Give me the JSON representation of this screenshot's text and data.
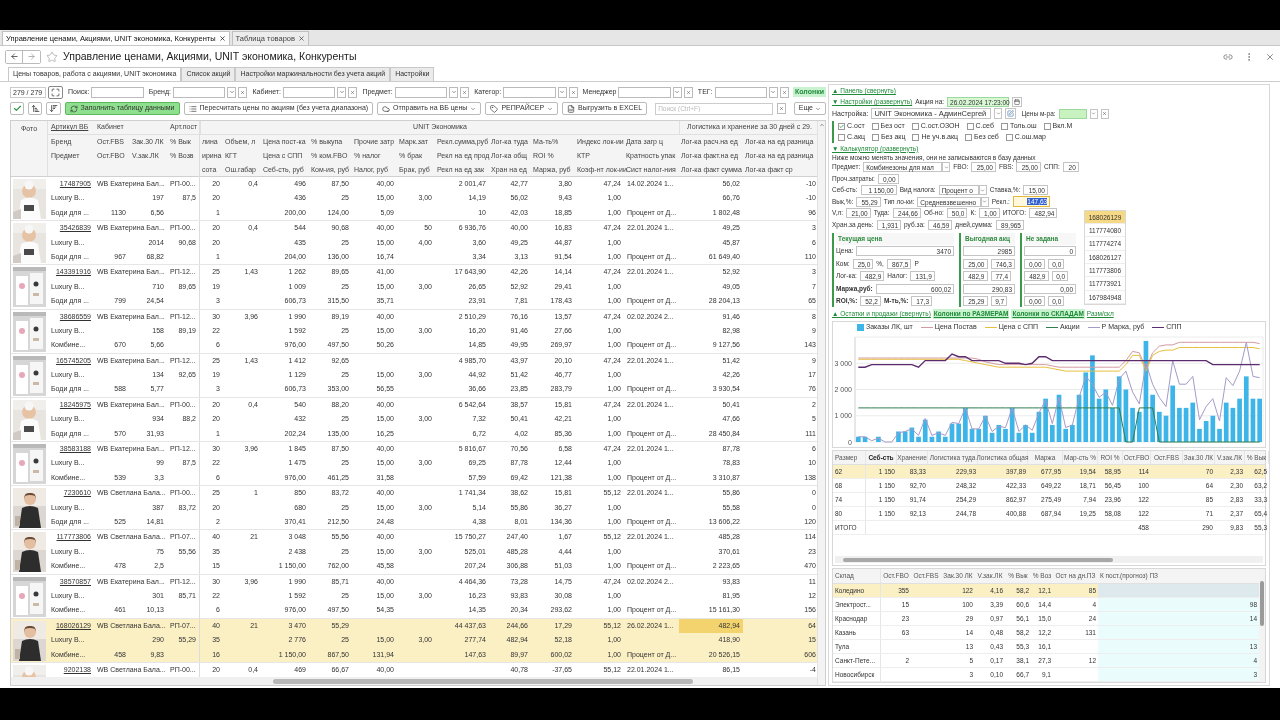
{
  "page_tabs": [
    {
      "label": "Управление ценами, Акциями, UNIT экономика, Конкуренты",
      "selected": true
    },
    {
      "label": "Таблица товаров",
      "selected": false
    }
  ],
  "window": {
    "title": "Управление ценами, Акциями, UNIT экономика, Конкуренты"
  },
  "tabs": [
    {
      "label": "Цены товаров, работа с акциями, UNIT экономика",
      "selected": true
    },
    {
      "label": "Список акций",
      "selected": false
    },
    {
      "label": "Настройки маржинальности без учета акций",
      "selected": false
    },
    {
      "label": "Настройки",
      "selected": false
    }
  ],
  "filters": {
    "counter": "279 / 279",
    "fields": [
      {
        "label": "Поиск:",
        "kind": "text"
      },
      {
        "label": "Бренд:",
        "kind": "select"
      },
      {
        "label": "Кабинет:",
        "kind": "select"
      },
      {
        "label": "Предмет:",
        "kind": "select"
      },
      {
        "label": "Категор:",
        "kind": "select"
      },
      {
        "label": "Менеджер",
        "kind": "select"
      },
      {
        "label": "ТЕГ:",
        "kind": "select"
      }
    ],
    "columns_link": "Колонки"
  },
  "toolbar": {
    "buttons": [
      {
        "label": "Заполнить таблицу данными",
        "kind": "primary"
      },
      {
        "label": "Пересчитать цены по акциям (без учета диапазона)",
        "kind": "plain"
      },
      {
        "label": "Отправить на ВБ цены",
        "kind": "menu"
      },
      {
        "label": "РЕПРАЙСЕР",
        "kind": "menu"
      },
      {
        "label": "Выгрузить в EXCEL",
        "kind": "plain"
      }
    ],
    "search_placeholder": "Поиск (Ctrl+F)",
    "more": "Еще"
  },
  "table": {
    "photo_header": "Фото",
    "fixed_columns": [
      {
        "labels": [
          "Артикул ВБ",
          "Бренд",
          "Предмет"
        ]
      },
      {
        "labels": [
          "Кабинет",
          "Ост.FBS",
          "Ост.FBO"
        ]
      },
      {
        "labels": [
          "Зак.30 ЛК",
          "V.зак.ЛК"
        ]
      },
      {
        "labels": [
          "Арт.пост",
          "% Вык",
          "% Возв"
        ]
      }
    ],
    "groups": [
      {
        "label": "UNIT Экономика",
        "columns": [
          {
            "labels": [
              "лина",
              "ирина",
              "сота"
            ]
          },
          {
            "labels": [
              "Объем, л",
              "КГТ",
              "Ош.габар"
            ]
          },
          {
            "labels": [
              "Цена пост-ка",
              "Цена с СПП",
              "Себ-сть, руб"
            ]
          },
          {
            "labels": [
              "% выкупа",
              "% ком.FBO",
              "Ком-ия, руб"
            ]
          },
          {
            "labels": [
              "Прочие затр",
              "% налог",
              "Налог, руб"
            ]
          },
          {
            "labels": [
              "Марк.зат",
              "% брак",
              "Брак, руб"
            ]
          },
          {
            "labels": [
              "Рекл.сумма,руб",
              "Рекл на ед прод",
              "Рекл на ед зак"
            ]
          },
          {
            "labels": [
              "Лог-ка туда",
              "Лог-ка общ",
              "Хран на ед"
            ]
          },
          {
            "labels": [
              "Ма-ть%",
              "ROI %",
              "Маржа, руб"
            ]
          },
          {
            "labels": [
              "Индекс лок-ии",
              "КТР",
              "Коэф-нт лок-ии"
            ]
          },
          {
            "labels": [
              "Дата загр ц",
              "Кратность упак",
              "Сист налог-ния"
            ]
          }
        ]
      },
      {
        "label": "Логистика и хранение за 30 дней с 29.",
        "columns": [
          {
            "labels": [
              "Лог-ка расч.на ед",
              "Лог-ка факт.на ед",
              "Лог-ка факт сумма"
            ]
          },
          {
            "labels": [
              "Лог-ка на ед разница",
              "Лог-ка на ед разница",
              "Лог-ка факт ср"
            ]
          }
        ]
      }
    ]
  },
  "products": [
    {
      "selected": false,
      "rows": [
        [
          "17487905",
          "WB Екатерина Бал...",
          null,
          "РП-00...",
          "20",
          "0,4",
          "496",
          "87,50",
          "40,00",
          null,
          "2 001,47",
          "42,77",
          "3,80",
          "47,24",
          "14.02.2024 1...",
          "56,02",
          "-10"
        ],
        [
          "Luxury B...",
          null,
          "197",
          "87,5",
          "20",
          null,
          "436",
          "25",
          "15,00",
          "3,00",
          "14,19",
          "56,02",
          "9,43",
          "1,00",
          null,
          "66,76",
          "-10"
        ],
        [
          "Боди для ...",
          "1130",
          "6,56",
          null,
          "1",
          null,
          "200,00",
          "124,00",
          "5,09",
          null,
          "10",
          "42,03",
          "18,85",
          "1,00",
          "Процент от Д...",
          "1 802,48",
          "96"
        ]
      ]
    },
    {
      "selected": false,
      "rows": [
        [
          "35426839",
          "WB Екатерина Бал...",
          null,
          "РП-00...",
          "20",
          "0,4",
          "544",
          "90,68",
          "40,00",
          "50",
          "6 936,76",
          "40,00",
          "16,83",
          "47,24",
          "22.01.2024 1...",
          "49,25",
          "3"
        ],
        [
          "Luxury B...",
          null,
          "2014",
          "90,68",
          "20",
          null,
          "435",
          "25",
          "15,00",
          "4,00",
          "3,60",
          "49,25",
          "44,87",
          "1,00",
          null,
          "45,87",
          "6"
        ],
        [
          "Боди для ...",
          "967",
          "68,82",
          null,
          "1",
          null,
          "204,00",
          "136,00",
          "16,74",
          null,
          "3,34",
          "3,13",
          "91,54",
          "1,00",
          "Процент от Д...",
          "61 649,40",
          "110"
        ]
      ]
    },
    {
      "selected": false,
      "rows": [
        [
          "143391916",
          "WB Екатерина Бал...",
          null,
          "РП-12...",
          "25",
          "1,43",
          "1 262",
          "89,65",
          "41,00",
          null,
          "17 643,90",
          "42,26",
          "14,14",
          "47,24",
          "22.01.2024 1...",
          "52,92",
          "3"
        ],
        [
          "Luxury B...",
          null,
          "710",
          "89,65",
          "19",
          null,
          "1 009",
          "25",
          "15,00",
          "3,00",
          "26,65",
          "52,92",
          "29,41",
          "1,00",
          null,
          "49,05",
          "7"
        ],
        [
          "Боди для ...",
          "799",
          "24,54",
          null,
          "3",
          null,
          "606,73",
          "315,50",
          "35,71",
          null,
          "23,91",
          "7,81",
          "178,43",
          "1,00",
          "Процент от Д...",
          "28 204,13",
          "65"
        ]
      ]
    },
    {
      "selected": false,
      "rows": [
        [
          "38686559",
          "WB Екатерина Бал...",
          null,
          "РП-12...",
          "30",
          "3,96",
          "1 990",
          "89,19",
          "40,00",
          null,
          "2 510,29",
          "76,16",
          "13,57",
          "47,24",
          "02.02.2024 2...",
          "91,46",
          "8"
        ],
        [
          "Luxury B...",
          null,
          "158",
          "89,19",
          "22",
          null,
          "1 592",
          "25",
          "15,00",
          "3,00",
          "16,20",
          "91,46",
          "27,66",
          "1,00",
          null,
          "82,98",
          "9"
        ],
        [
          "Комбине...",
          "670",
          "5,66",
          null,
          "6",
          null,
          "976,00",
          "497,50",
          "50,26",
          null,
          "14,85",
          "49,95",
          "269,97",
          "1,00",
          "Процент от Д...",
          "9 127,56",
          "143"
        ]
      ]
    },
    {
      "selected": false,
      "rows": [
        [
          "165745205",
          "WB Екатерина Бал...",
          null,
          "РП-12...",
          "25",
          "1,43",
          "1 412",
          "92,65",
          null,
          null,
          "4 985,70",
          "43,97",
          "20,10",
          "47,24",
          "22.01.2024 1...",
          "51,42",
          "9"
        ],
        [
          "Luxury B...",
          null,
          "134",
          "92,65",
          "19",
          null,
          "1 129",
          "25",
          "15,00",
          "3,00",
          "44,92",
          "51,42",
          "46,77",
          "1,00",
          null,
          "42,26",
          "17"
        ],
        [
          "Боди для ...",
          "588",
          "5,77",
          null,
          "3",
          null,
          "606,73",
          "353,00",
          "56,55",
          null,
          "36,66",
          "23,85",
          "283,79",
          "1,00",
          "Процент от Д...",
          "3 930,54",
          "76"
        ]
      ]
    },
    {
      "selected": false,
      "rows": [
        [
          "18245975",
          "WB Екатерина Бал...",
          null,
          "РП-00...",
          "20",
          "0,4",
          "540",
          "88,20",
          "40,00",
          null,
          "6 542,64",
          "38,57",
          "15,81",
          "47,24",
          "22.01.2024 1...",
          "50,41",
          "2"
        ],
        [
          "Luxury B...",
          null,
          "934",
          "88,2",
          "20",
          null,
          "432",
          "25",
          "15,00",
          "3,00",
          "7,32",
          "50,41",
          "42,21",
          "1,00",
          null,
          "47,66",
          "5"
        ],
        [
          "Боди для ...",
          "570",
          "31,93",
          null,
          "1",
          null,
          "202,24",
          "135,00",
          "16,25",
          null,
          "6,72",
          "4,02",
          "85,36",
          "1,00",
          "Процент от Д...",
          "28 450,84",
          "111"
        ]
      ]
    },
    {
      "selected": false,
      "rows": [
        [
          "38583188",
          "WB Екатерина Бал...",
          null,
          "РП-12...",
          "30",
          "3,96",
          "1 845",
          "87,50",
          "40,00",
          null,
          "5 816,67",
          "70,56",
          "6,58",
          "47,24",
          "22.01.2024 1...",
          "87,78",
          "6"
        ],
        [
          "Luxury B...",
          null,
          "99",
          "87,5",
          "22",
          null,
          "1 475",
          "25",
          "15,00",
          "3,00",
          "69,25",
          "87,78",
          "12,44",
          "1,00",
          null,
          "78,83",
          "10"
        ],
        [
          "Комбине...",
          "539",
          "3,3",
          null,
          "6",
          null,
          "976,00",
          "461,25",
          "31,58",
          null,
          "57,59",
          "69,42",
          "121,38",
          "1,00",
          "Процент от Д...",
          "3 310,87",
          "138"
        ]
      ]
    },
    {
      "selected": false,
      "rows": [
        [
          "7230610",
          "WB Светлана Бала...",
          null,
          "РП-00...",
          "25",
          "1",
          "850",
          "83,72",
          "40,00",
          null,
          "1 741,34",
          "38,62",
          "15,81",
          "55,12",
          "22.01.2024 1...",
          "55,86",
          "0"
        ],
        [
          "Luxury B...",
          null,
          "387",
          "83,72",
          "20",
          null,
          "680",
          "25",
          "15,00",
          "3,00",
          "5,14",
          "55,86",
          "36,27",
          "1,00",
          null,
          "55,58",
          "0"
        ],
        [
          "Боди для ...",
          "525",
          "14,81",
          null,
          "2",
          null,
          "370,41",
          "212,50",
          "24,48",
          null,
          "4,38",
          "8,01",
          "134,36",
          "1,00",
          "Процент от Д...",
          "13 606,22",
          "120"
        ]
      ]
    },
    {
      "selected": false,
      "rows": [
        [
          "117773806",
          "WB Светлана Бала...",
          null,
          "РП-07...",
          "40",
          "21",
          "3 048",
          "55,56",
          "40,00",
          null,
          "15 750,27",
          "247,40",
          "1,67",
          "55,12",
          "22.01.2024 1...",
          "485,28",
          "114"
        ],
        [
          "Luxury B...",
          null,
          "75",
          "55,56",
          "35",
          null,
          "2 438",
          "25",
          "15,00",
          "3,00",
          "525,01",
          "485,28",
          "4,44",
          "1,00",
          null,
          "370,61",
          "23"
        ],
        [
          "Комбине...",
          "478",
          "2,5",
          null,
          "15",
          null,
          "1 150,00",
          "762,00",
          "45,58",
          null,
          "207,24",
          "306,88",
          "51,03",
          "1,00",
          "Процент от Д...",
          "2 223,65",
          "470"
        ]
      ]
    },
    {
      "selected": false,
      "rows": [
        [
          "38570857",
          "WB Екатерина Бал...",
          null,
          "РП-12...",
          "30",
          "3,96",
          "1 990",
          "85,71",
          "40,00",
          null,
          "4 464,36",
          "73,28",
          "14,75",
          "47,24",
          "02.02.2024 2...",
          "93,83",
          "11"
        ],
        [
          "Luxury B...",
          null,
          "301",
          "85,71",
          "22",
          null,
          "1 592",
          "25",
          "15,00",
          "3,00",
          "16,23",
          "93,83",
          "30,08",
          "1,00",
          null,
          "81,95",
          "12"
        ],
        [
          "Комбине...",
          "461",
          "10,13",
          null,
          "6",
          null,
          "976,00",
          "497,50",
          "54,35",
          null,
          "14,35",
          "20,34",
          "293,62",
          "1,00",
          "Процент от Д...",
          "15 161,30",
          "156"
        ]
      ]
    },
    {
      "selected": true,
      "rows": [
        [
          "168026129",
          "WB Светлана Бала...",
          null,
          "РП-07...",
          "40",
          "21",
          "3 470",
          "55,29",
          null,
          null,
          "44 437,63",
          "244,66",
          "17,29",
          "55,12",
          "26.02.2024 1...",
          {
            "text": "482,94",
            "focused": true
          },
          "64"
        ],
        [
          "Luxury B...",
          null,
          "290",
          "55,29",
          "35",
          null,
          "2 776",
          "25",
          "15,00",
          "3,00",
          "277,74",
          "482,94",
          "52,18",
          "1,00",
          null,
          "418,90",
          "15"
        ],
        [
          "Комбине...",
          "458",
          "9,83",
          null,
          "16",
          null,
          "1 150,00",
          "867,50",
          "131,94",
          null,
          "147,63",
          "89,97",
          "600,02",
          "1,00",
          "Процент от Д...",
          "20 526,15",
          "606"
        ]
      ]
    },
    {
      "selected": false,
      "rows": [
        [
          "9202138",
          "WB Светлана Бала...",
          null,
          "РП-00...",
          "20",
          "0,4",
          "469",
          "66,67",
          "40,00",
          null,
          null,
          "40,78",
          "-37,65",
          "55,12",
          "22.01.2024 1...",
          "86,15",
          "-4"
        ]
      ]
    }
  ],
  "settings": {
    "panel_link": "▲ Панель (свернуть)",
    "settings_link": "▼ Настройки (развернуть)",
    "promo_label": "Акция на:",
    "promo_date": "26.02.2024 17:23:00",
    "preset_label": "Настройка:",
    "preset": "UNIT Экономика - АдминСергей",
    "prices_label": "Цены м-ра:",
    "options": [
      [
        {
          "label": "С.ост",
          "checked": true
        },
        {
          "label": "Без ост",
          "checked": false
        },
        {
          "label": "С.ост.ОЗОН",
          "checked": false
        },
        {
          "label": "С.себ",
          "checked": false
        },
        {
          "label": "Толь.ош",
          "checked": false
        },
        {
          "label": "Вкл.М",
          "checked": false
        }
      ],
      [
        {
          "label": "С.акц",
          "checked": false
        },
        {
          "label": "Без акц",
          "checked": false
        },
        {
          "label": "Не уч.в.акц",
          "checked": false
        },
        {
          "label": "Без себ",
          "checked": false
        },
        {
          "label": "С.ош.мар",
          "checked": false
        }
      ]
    ]
  },
  "calculator": {
    "link": "▼ Калькулятор (развернуть)",
    "note": "Ниже можно менять значения, они не записываются в базу данных",
    "rows": [
      {
        "items": [
          {
            "kind": "label",
            "text": "Предмет:"
          },
          {
            "kind": "select",
            "value": "Комбинезоны для мал"
          },
          {
            "kind": "label",
            "text": "FBO:"
          },
          {
            "kind": "field",
            "value": "25,00"
          },
          {
            "kind": "label",
            "text": "FBS:"
          },
          {
            "kind": "field",
            "value": "25,00"
          },
          {
            "kind": "label",
            "text": "СПП:"
          },
          {
            "kind": "field",
            "value": "20"
          }
        ]
      },
      {
        "items": [
          {
            "kind": "label",
            "text": "Проч.затраты:"
          },
          {
            "kind": "field",
            "value": "0,00"
          }
        ]
      },
      {
        "items": [
          {
            "kind": "label",
            "text": "Себ-сть:"
          },
          {
            "kind": "field",
            "value": "1 150,00"
          },
          {
            "kind": "label",
            "text": "Вид налога:"
          },
          {
            "kind": "select",
            "value": "Процент о"
          },
          {
            "kind": "label",
            "text": "Ставка,%:"
          },
          {
            "kind": "field",
            "value": "15,00"
          }
        ]
      },
      {
        "items": [
          {
            "kind": "label",
            "text": "Вык,%:"
          },
          {
            "kind": "field",
            "value": "55,29"
          },
          {
            "kind": "label",
            "text": "Тип ло-ки:"
          },
          {
            "kind": "select",
            "value": "Средневзвешенно"
          },
          {
            "kind": "label",
            "text": "Рекл.:"
          },
          {
            "kind": "active_field",
            "value": "147,63"
          }
        ]
      },
      {
        "items": [
          {
            "kind": "label",
            "text": "V,л:"
          },
          {
            "kind": "field",
            "value": "21,00"
          },
          {
            "kind": "label",
            "text": "Туда:"
          },
          {
            "kind": "field",
            "value": "244,66"
          },
          {
            "kind": "label",
            "text": "Об-но:"
          },
          {
            "kind": "field",
            "value": "50,0"
          },
          {
            "kind": "label",
            "text": "К:"
          },
          {
            "kind": "field",
            "value": "1,00"
          },
          {
            "kind": "label",
            "text": "ИТОГО:"
          },
          {
            "kind": "field",
            "value": "482,94"
          }
        ]
      },
      {
        "items": [
          {
            "kind": "label",
            "text": "Хран.за день:"
          },
          {
            "kind": "field",
            "value": "1,931"
          },
          {
            "kind": "label",
            "text": "руб.за:"
          },
          {
            "kind": "field",
            "value": "46,59"
          },
          {
            "kind": "label",
            "text": "дней,сумма:"
          },
          {
            "kind": "field",
            "value": "89,965"
          }
        ]
      }
    ],
    "blocks": [
      {
        "title": "Текущая цена",
        "rows": [
          {
            "items": [
              {
                "kind": "label",
                "text": "Цена:"
              },
              {
                "kind": "wide",
                "value": "3470"
              }
            ]
          },
          {
            "items": [
              {
                "kind": "label",
                "text": "Ком:"
              },
              {
                "kind": "field",
                "value": "25,0"
              },
              {
                "kind": "label",
                "text": "%,"
              },
              {
                "kind": "field",
                "value": "867,5"
              },
              {
                "kind": "label",
                "text": "Р"
              }
            ]
          },
          {
            "items": [
              {
                "kind": "label",
                "text": "Лог-ка:"
              },
              {
                "kind": "field",
                "value": "482,9"
              },
              {
                "kind": "label",
                "text": "Налог:"
              },
              {
                "kind": "field",
                "value": "131,9"
              }
            ]
          },
          {
            "items": [
              {
                "kind": "strong",
                "text": "Маржа,руб:"
              },
              {
                "kind": "wide",
                "value": "600,02"
              }
            ]
          },
          {
            "items": [
              {
                "kind": "strong",
                "text": "ROI,%:"
              },
              {
                "kind": "field",
                "value": "52,2"
              },
              {
                "kind": "strong",
                "text": "М-ть,%:"
              },
              {
                "kind": "field",
                "value": "17,3"
              }
            ]
          }
        ]
      },
      {
        "title": "Выгодная акц",
        "rows": [
          {
            "items": [
              {
                "kind": "wide",
                "value": "2985"
              }
            ]
          },
          {
            "items": [
              {
                "kind": "field",
                "value": "25,00"
              },
              {
                "kind": "field",
                "value": "746,3"
              }
            ]
          },
          {
            "items": [
              {
                "kind": "field",
                "value": "482,9"
              },
              {
                "kind": "field",
                "value": "77,4"
              }
            ]
          },
          {
            "items": [
              {
                "kind": "wide",
                "value": "290,83"
              }
            ]
          },
          {
            "items": [
              {
                "kind": "field",
                "value": "25,29"
              },
              {
                "kind": "field",
                "value": "9,7"
              }
            ]
          }
        ]
      },
      {
        "title": "Не задана",
        "rows": [
          {
            "items": [
              {
                "kind": "wide",
                "value": "0"
              }
            ]
          },
          {
            "items": [
              {
                "kind": "field",
                "value": "0,00"
              },
              {
                "kind": "field",
                "value": "0,0"
              }
            ]
          },
          {
            "items": [
              {
                "kind": "field",
                "value": "482,9"
              },
              {
                "kind": "field",
                "value": "0,0"
              }
            ]
          },
          {
            "items": [
              {
                "kind": "wide",
                "value": "0,00"
              }
            ]
          },
          {
            "items": [
              {
                "kind": "field",
                "value": "0,00"
              },
              {
                "kind": "field",
                "value": "0,0"
              }
            ]
          }
        ]
      }
    ],
    "articles": [
      {
        "text": "168026129",
        "selected": true
      },
      {
        "text": "117774080",
        "selected": false
      },
      {
        "text": "117774274",
        "selected": false
      },
      {
        "text": "168026127",
        "selected": false
      },
      {
        "text": "117773806",
        "selected": false
      },
      {
        "text": "117773921",
        "selected": false
      },
      {
        "text": "167984948",
        "selected": false
      }
    ]
  },
  "stock_links": [
    {
      "text": "▲ Остатки и продажи (свернуть)",
      "kind": "link"
    },
    {
      "text": "Колонки по РАЗМЕРАМ",
      "kind": "accent"
    },
    {
      "text": "Колонки по СКЛАДАМ",
      "kind": "accent"
    },
    {
      "text": "Разм/скл",
      "kind": "link"
    }
  ],
  "chart": {
    "chart_data": {
      "type": "bar",
      "grid": true,
      "ylim": [
        0,
        4000
      ],
      "yticks": [
        0,
        {
          "value": 1000,
          "label": "1 000"
        },
        {
          "value": 2000,
          "label": "2 000"
        },
        {
          "value": 3000,
          "label": "3 000"
        }
      ],
      "series": [
        {
          "name": "Заказы ЛК, шт",
          "type": "bar",
          "color": "#3db5e8",
          "values": [
            200,
            200,
            0,
            200,
            0,
            0,
            400,
            400,
            550,
            200,
            850,
            200,
            400,
            200,
            700,
            700,
            1300,
            500,
            500,
            1000,
            350,
            650,
            500,
            1300,
            350,
            650,
            350,
            1150,
            1650,
            650,
            1800,
            500,
            650,
            1800,
            2650,
            3300,
            1650,
            2000,
            1300,
            2500,
            2000,
            1300,
            1150,
            3850,
            1800,
            1150,
            1000,
            2150,
            1300,
            1300,
            1500,
            500,
            800,
            1000,
            500,
            1500,
            1300,
            1650,
            2500,
            1650,
            1650
          ]
        },
        {
          "name": "Цена Постав",
          "type": "line",
          "color": "#d49aa2",
          "values": [
            3200,
            3200,
            3200,
            3200,
            3200,
            3200,
            3200,
            3200,
            3200,
            3200,
            3200,
            3200,
            3200,
            3200,
            3200,
            3200,
            3200,
            3200,
            3150,
            3050,
            3000,
            2950,
            2950,
            2950,
            2950,
            2950,
            2950,
            2950,
            2950,
            2900,
            2850,
            2850,
            2850,
            2850,
            2850,
            2850,
            2850,
            2850,
            2850,
            2850,
            3100,
            3450,
            3400,
            2800,
            3400,
            3650,
            3700,
            3700,
            3800,
            3800,
            3800,
            3800,
            3800,
            3800,
            3800,
            3800,
            3800,
            3800,
            3800,
            3800,
            3750
          ]
        },
        {
          "name": "Цена с СПП",
          "type": "line",
          "color": "#e6bf3e",
          "values": [
            3150,
            3150,
            3150,
            3150,
            3150,
            3150,
            3150,
            3150,
            3150,
            3150,
            3150,
            3150,
            3150,
            3150,
            3150,
            3150,
            3100,
            3050,
            3000,
            2950,
            2900,
            2850,
            2850,
            2850,
            2850,
            2850,
            2850,
            2850,
            2850,
            2800,
            2750,
            2700,
            2700,
            2700,
            2700,
            2700,
            2700,
            2700,
            2700,
            2700,
            2950,
            3300,
            3300,
            2700,
            3300,
            3450,
            3500,
            3500,
            3600,
            3600,
            3600,
            3600,
            3600,
            3600,
            3600,
            3600,
            3600,
            3600,
            3600,
            3600,
            3550
          ]
        },
        {
          "name": "Акции",
          "type": "line",
          "color": "#2e7d4f",
          "values": [
            1300,
            1300,
            1300,
            1300,
            1300,
            1300,
            1300,
            1300,
            1300,
            1300,
            1300,
            1300,
            1300,
            1300,
            1300,
            1300,
            1300,
            1300,
            1300,
            1300,
            1300,
            1300,
            1300,
            1300,
            1300,
            1300,
            1300,
            1300,
            1300,
            1300,
            1300,
            1300,
            1300,
            1300,
            1300,
            1300,
            1300,
            1300,
            1300,
            1300,
            0,
            0,
            1300,
            1300,
            1300,
            0,
            0,
            0,
            0,
            0,
            0,
            0,
            0,
            0,
            0,
            0,
            0,
            0,
            0,
            0,
            0
          ]
        },
        {
          "name": "Р Марка, руб",
          "type": "line",
          "color": "#a59ac8",
          "values": [
            200,
            200,
            50,
            150,
            0,
            0,
            350,
            400,
            500,
            250,
            900,
            250,
            350,
            250,
            750,
            700,
            1300,
            500,
            500,
            1000,
            400,
            600,
            550,
            1300,
            400,
            650,
            450,
            1100,
            1600,
            700,
            1700,
            550,
            650,
            1700,
            2500,
            2200,
            1700,
            1900,
            1400,
            2400,
            2700,
            1900,
            1450,
            3000,
            2200,
            1700,
            1350,
            3100,
            2200,
            2200,
            2500,
            850,
            1350,
            1650,
            800,
            2450,
            2150,
            2700,
            3800,
            2500,
            2450
          ]
        },
        {
          "name": "СПП",
          "type": "line",
          "color": "#5b2c6f",
          "values": [
            2850,
            2850,
            2950,
            2950,
            2950,
            2950,
            2950,
            2950,
            2950,
            2850,
            3100,
            3100,
            3100,
            3100,
            3350,
            3250,
            3250,
            3100,
            3100,
            3100,
            3100,
            3100,
            3000,
            3000,
            3000,
            2950,
            3000,
            3250,
            3250,
            3100,
            3100,
            3100,
            3100,
            3100,
            3100,
            3100,
            3100,
            3100,
            3100,
            3100,
            3100,
            3100,
            3100,
            3100,
            3100,
            3100,
            3100,
            3100,
            3100,
            3100,
            3100,
            3100,
            3100,
            2950,
            2950,
            2950,
            2950,
            2950,
            2950,
            2950,
            2950
          ]
        }
      ]
    }
  },
  "sizes": {
    "columns": [
      {
        "label": "Размер",
        "sorted": false
      },
      {
        "label": "Себ-сть",
        "sorted": true
      },
      {
        "label": "Хранение",
        "sorted": false
      },
      {
        "label": "Логистика туда",
        "sorted": false
      },
      {
        "label": "Логистика общая",
        "sorted": false
      },
      {
        "label": "Маржа",
        "sorted": false
      },
      {
        "label": "Мар-сть %",
        "sorted": false
      },
      {
        "label": "ROI %",
        "sorted": false
      },
      {
        "label": "Ост.FBO",
        "sorted": false
      },
      {
        "label": "Ост.FBS",
        "sorted": false
      },
      {
        "label": "Зак.30 ЛК",
        "sorted": false
      },
      {
        "label": "V.зак.ЛК",
        "sorted": false
      },
      {
        "label": "% Вык",
        "sorted": false
      }
    ],
    "rows": [
      {
        "cells": [
          "62",
          "1 150",
          "83,33",
          "229,93",
          "397,89",
          "677,95",
          "19,54",
          "58,95",
          "114",
          null,
          "70",
          "2,33",
          "62,5"
        ],
        "selected": true
      },
      {
        "cells": [
          "68",
          "1 150",
          "92,70",
          "248,32",
          "422,33",
          "649,22",
          "18,71",
          "56,45",
          "100",
          null,
          "64",
          "2,30",
          "63,2"
        ],
        "selected": false
      },
      {
        "cells": [
          "74",
          "1 150",
          "91,74",
          "254,29",
          "862,97",
          "275,49",
          "7,94",
          "23,96",
          "122",
          null,
          "85",
          "2,83",
          "33,3"
        ],
        "selected": false
      },
      {
        "cells": [
          "80",
          "1 150",
          "92,13",
          "244,78",
          "400,88",
          "687,94",
          "19,25",
          "58,08",
          "122",
          null,
          "71",
          "2,37",
          "65,4"
        ],
        "selected": false
      },
      {
        "cells": [
          "ИТОГО",
          null,
          null,
          null,
          null,
          null,
          null,
          null,
          "458",
          null,
          "290",
          "9,83",
          "55,3"
        ],
        "selected": false
      }
    ]
  },
  "warehouses": {
    "columns": [
      {
        "label": "Склад",
        "shaded": false
      },
      {
        "label": "Ост.FBO",
        "shaded": false
      },
      {
        "label": "Ост.FBS",
        "shaded": false
      },
      {
        "label": "Зак.30 ЛК",
        "shaded": false
      },
      {
        "label": "V.зак.ЛК",
        "shaded": false
      },
      {
        "label": "% Вык",
        "shaded": false
      },
      {
        "label": "% Воз",
        "shaded": false
      },
      {
        "label": "Ост на дн.ПЗ",
        "shaded": false
      },
      {
        "label": "К пост.(прогноз) ПЗ",
        "shaded": true
      }
    ],
    "rows": [
      {
        "cells": [
          "Коледино",
          "355",
          null,
          "122",
          "4,16",
          "58,2",
          "12,1",
          "85",
          null
        ],
        "selected": true
      },
      {
        "cells": [
          "Электрост...",
          "15",
          null,
          "100",
          "3,39",
          "60,6",
          "14,4",
          "4",
          "98"
        ],
        "selected": false
      },
      {
        "cells": [
          "Краснодар",
          "23",
          null,
          "29",
          "0,97",
          "56,1",
          "15,0",
          "24",
          "14"
        ],
        "selected": false
      },
      {
        "cells": [
          "Казань",
          "63",
          null,
          "14",
          "0,48",
          "58,2",
          "12,2",
          "131",
          null
        ],
        "selected": false
      },
      {
        "cells": [
          "Тула",
          null,
          null,
          "13",
          "0,43",
          "55,3",
          "16,1",
          null,
          "13"
        ],
        "selected": false
      },
      {
        "cells": [
          "Санкт-Пете...",
          "2",
          null,
          "5",
          "0,17",
          "38,1",
          "27,3",
          "12",
          "4"
        ],
        "selected": false
      },
      {
        "cells": [
          "Новосибирск",
          null,
          null,
          "3",
          "0,10",
          "66,7",
          "9,1",
          null,
          "3"
        ],
        "selected": false
      }
    ]
  }
}
